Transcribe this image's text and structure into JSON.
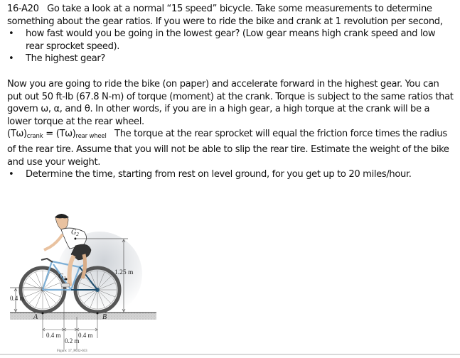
{
  "problem": {
    "number": "16-A20",
    "intro": "Go take a look at a normal “15 speed” bicycle.  Take some measurements to determine something about the gear ratios.  If you were to ride the bike and crank at 1 revolution per second,",
    "bullets_1": [
      "how fast would you be going in the lowest gear? (Low gear means high crank speed and low rear sprocket speed).",
      "The highest gear?"
    ],
    "para2": "Now you are going to ride the bike (on paper) and accelerate forward in the highest gear. You can put out 50 ft-lb (67.8 N-m) of torque (moment) at the crank.  Torque is subject to the same ratios that govern ω, α, and θ.  In other words, if you are in a high gear, a high torque at the crank will be a lower torque at the rear wheel.",
    "equation": {
      "lhs_main": "(Tω)",
      "lhs_sub": "crank",
      "equals": " = ",
      "rhs_main": "(Tω)",
      "rhs_sub": "rear wheel"
    },
    "para3": "The torque at the rear sprocket will equal the friction force times the radius of the rear tire.  Assume that you will not be able to slip the rear tire.  Estimate the weight of the bike and use your weight.",
    "bullets_2": [
      "Determine the time, starting from rest on level ground, for you get up to 20 miles/hour."
    ],
    "bullet_glyph": "•"
  },
  "figure": {
    "label_g1": "G",
    "label_g1_sub": "1",
    "label_g2": "G",
    "label_g2_sub": "2",
    "label_a": "A",
    "label_b": "B",
    "dim_height_total": "1.25 m",
    "dim_height_g1": "0.4 m",
    "dim_a_to_g1": "0.4 m",
    "dim_g1_to_g2": "0.2 m",
    "dim_g2_to_b": "0.4 m",
    "caption": "Figure: 17_P032-033"
  }
}
